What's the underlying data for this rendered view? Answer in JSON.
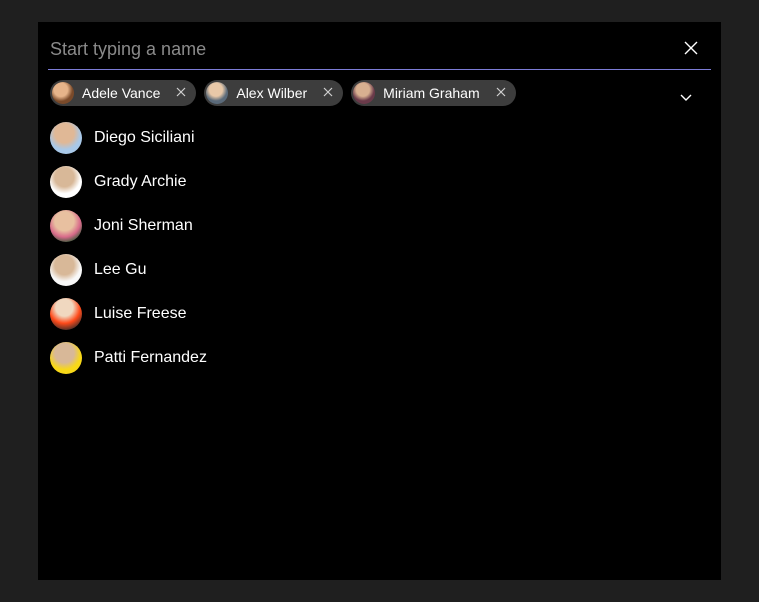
{
  "search": {
    "placeholder": "Start typing a name",
    "value": ""
  },
  "selected": [
    {
      "name": "Adele Vance",
      "avatar": "av-adele"
    },
    {
      "name": "Alex Wilber",
      "avatar": "av-alex"
    },
    {
      "name": "Miriam Graham",
      "avatar": "av-miriam"
    }
  ],
  "suggestions": [
    {
      "name": "Diego Siciliani",
      "avatar": "av-diego"
    },
    {
      "name": "Grady Archie",
      "avatar": "av-grady"
    },
    {
      "name": "Joni Sherman",
      "avatar": "av-joni"
    },
    {
      "name": "Lee Gu",
      "avatar": "av-lee"
    },
    {
      "name": "Luise Freese",
      "avatar": "av-luise"
    },
    {
      "name": "Patti Fernandez",
      "avatar": "av-patti"
    }
  ],
  "icons": {
    "close": "close-icon",
    "remove": "x-icon",
    "expand": "chevron-down-icon"
  },
  "colors": {
    "background": "#000000",
    "outer": "#1f1f1f",
    "chip": "#3d3d3d",
    "underline": "#7c7cd6",
    "text": "#ffffff",
    "placeholder": "#8a8a8a"
  }
}
